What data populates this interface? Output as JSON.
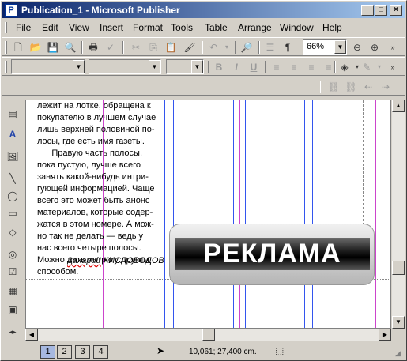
{
  "window": {
    "title": "Publication_1 - Microsoft Publisher",
    "app_icon": "P"
  },
  "menu": [
    "File",
    "Edit",
    "View",
    "Insert",
    "Format",
    "Tools",
    "Table",
    "Arrange",
    "Window",
    "Help"
  ],
  "standard_toolbar": {
    "zoom": "66%",
    "icons": [
      "new-icon",
      "open-icon",
      "save-icon",
      "print-preview-icon",
      "print-icon",
      "spelling-icon",
      "cut-icon",
      "copy-icon",
      "paste-icon",
      "format-painter-icon",
      "undo-icon",
      "find-icon",
      "columns-icon",
      "pilcrow-icon",
      "zoom-out-icon",
      "zoom-in-icon"
    ]
  },
  "formatting_toolbar": {
    "style": "",
    "font": "",
    "size": "",
    "buttons": {
      "bold": "B",
      "italic": "I",
      "underline": "U"
    }
  },
  "toolbox_icons": [
    "pointer-icon",
    "text-box-icon",
    "table-icon",
    "wordart-icon",
    "picture-icon",
    "line-icon",
    "oval-icon",
    "rectangle-icon",
    "autoshapes-icon",
    "hotspot-icon",
    "design-gallery-icon",
    "form-control-icon",
    "html-fragment-icon"
  ],
  "document": {
    "lines": [
      "лежит на лотке, обращена к",
      "покупателю в лучшем случае",
      "лишь верхней половиной по-",
      "лосы, где есть имя газеты.",
      "      Правую часть полосы,",
      "пока пустую, лучше всего",
      "занять какой-нибудь интри-",
      "гующей информацией. Чаще",
      "всего это может быть анонс",
      "материалов, которые содер-",
      "жатся в этом номере. А мож-",
      "но так не делать — ведь у",
      "нас всего четыре полосы.",
      "Можно дать интригу другим",
      "способом."
    ],
    "signature_first": "Захарий",
    "signature_last": " КИСЛОВОДОВ",
    "ad_text": "РЕКЛАМА"
  },
  "status": {
    "pages": [
      "1",
      "2",
      "3",
      "4"
    ],
    "active_page": "1",
    "coords": "10,061; 27,400 cm."
  }
}
